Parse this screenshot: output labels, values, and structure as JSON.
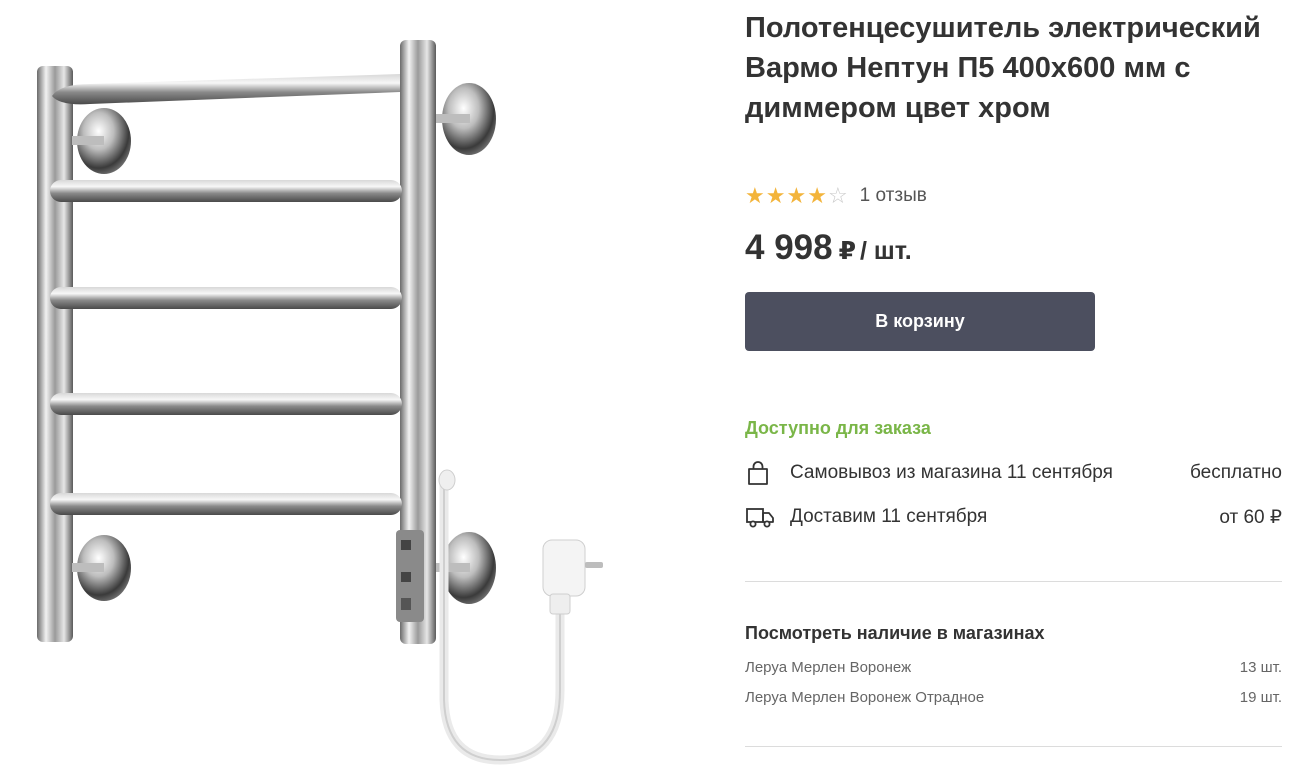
{
  "product": {
    "title": "Полотенцесушитель электрический Вармо Нептун П5 400x600 мм с диммером цвет хром",
    "rating": 4,
    "rating_max": 5,
    "reviews": "1 отзыв",
    "price": "4 998",
    "currency": "₽",
    "unit": "/ шт.",
    "cart_button": "В корзину"
  },
  "delivery": {
    "availability": "Доступно для заказа",
    "options": [
      {
        "icon": "shopping-bag-icon",
        "label": "Самовывоз из магазина 11 сентября",
        "price": "бесплатно"
      },
      {
        "icon": "delivery-truck-icon",
        "label": "Доставим 11 сентября",
        "price": "от 60 ₽"
      }
    ]
  },
  "stores": {
    "title": "Посмотреть наличие в магазинах",
    "items": [
      {
        "name": "Леруа Мерлен Воронеж",
        "qty": "13 шт."
      },
      {
        "name": "Леруа Мерлен Воронеж Отрадное",
        "qty": "19 шт."
      }
    ]
  },
  "colors": {
    "accent_button": "#4c4f5f",
    "available_green": "#7ab648",
    "star": "#f3b43b"
  }
}
